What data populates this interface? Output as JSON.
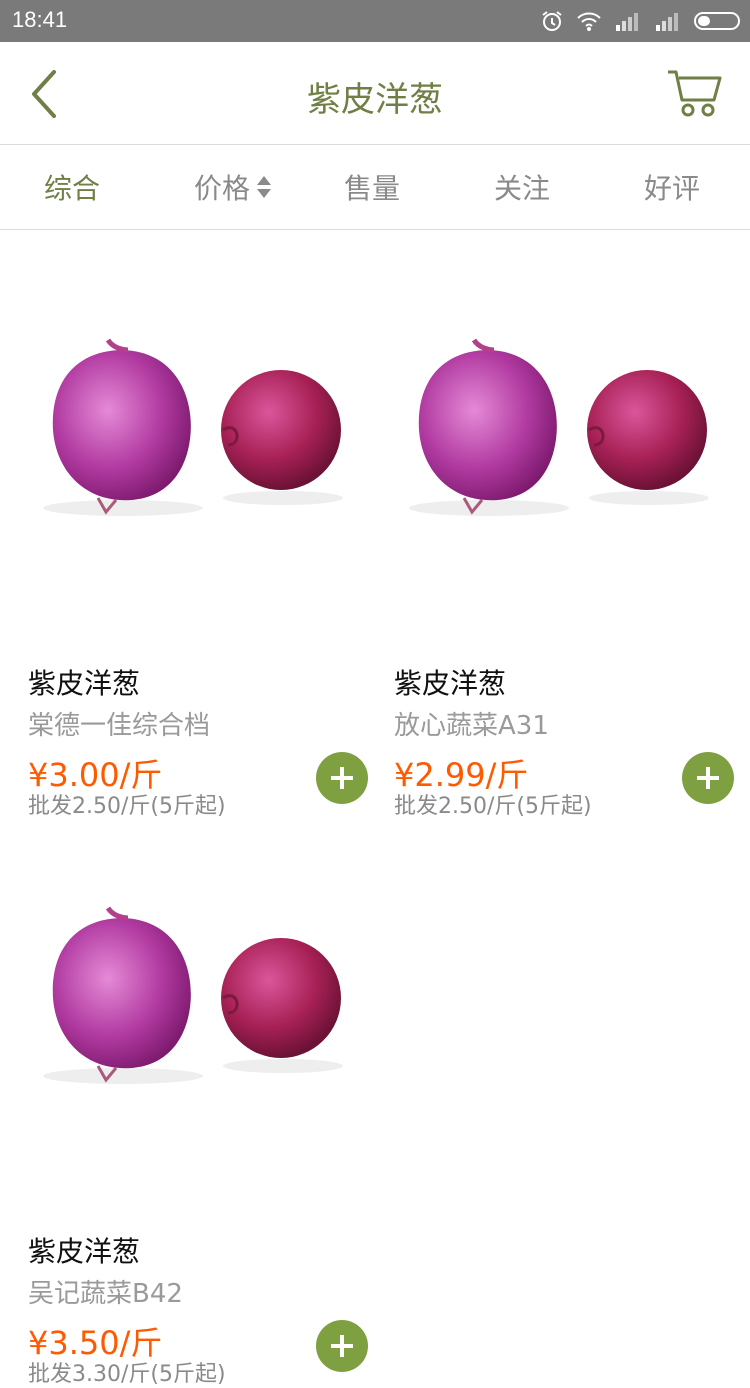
{
  "status": {
    "time": "18:41"
  },
  "header": {
    "title": "紫皮洋葱"
  },
  "sort_tabs": [
    {
      "label": "综合",
      "active": true
    },
    {
      "label": "价格",
      "active": false
    },
    {
      "label": "售量",
      "active": false
    },
    {
      "label": "关注",
      "active": false
    },
    {
      "label": "好评",
      "active": false
    }
  ],
  "products": [
    {
      "name": "紫皮洋葱",
      "shop": "棠德一佳综合档",
      "price": "¥3.00/斤",
      "wholesale": "批发2.50/斤(5斤起)"
    },
    {
      "name": "紫皮洋葱",
      "shop": "放心蔬菜A31",
      "price": "¥2.99/斤",
      "wholesale": "批发2.50/斤(5斤起)"
    },
    {
      "name": "紫皮洋葱",
      "shop": "吴记蔬菜B42",
      "price": "¥3.50/斤",
      "wholesale": "批发3.30/斤(5斤起)"
    }
  ],
  "colors": {
    "accent": "#6f7f45",
    "price": "#ff5a00",
    "add_button": "#7fa040"
  }
}
